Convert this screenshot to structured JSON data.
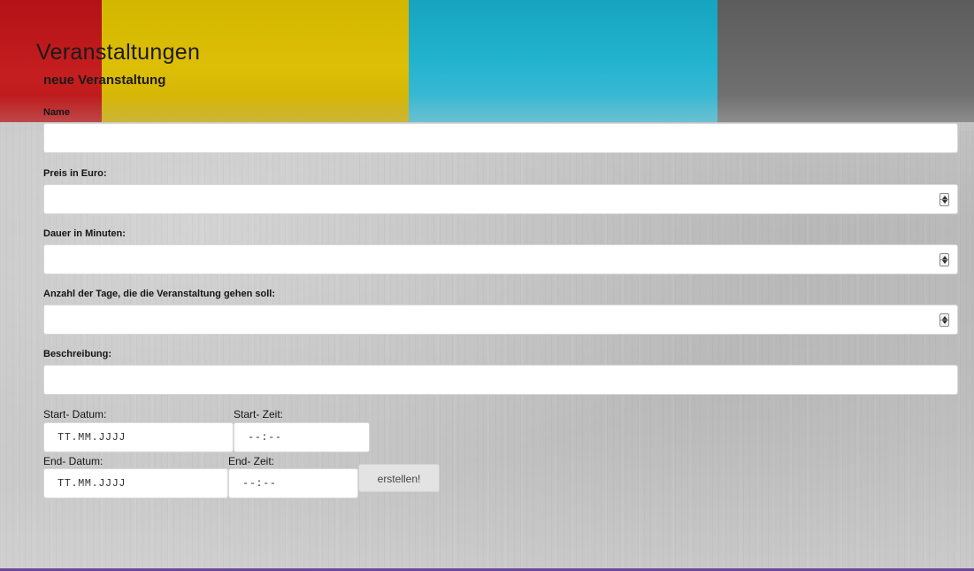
{
  "header": {
    "title": "Veranstaltungen",
    "subtitle": "neue Veranstaltung"
  },
  "form": {
    "name_label": "Name",
    "price_label": "Preis in Euro:",
    "duration_label": "Dauer in Minuten:",
    "days_label": "Anzahl der Tage, die die Veranstaltung gehen soll:",
    "description_label": "Beschreibung:",
    "start_date_label": "Start- Datum:",
    "start_date_placeholder": "TT.MM.JJJJ",
    "start_time_label": "Start- Zeit:",
    "start_time_placeholder": "--:--",
    "end_date_label": "End- Datum:",
    "end_date_placeholder": "TT.MM.JJJJ",
    "end_time_label": "End- Zeit:",
    "end_time_placeholder": "--:--",
    "submit_label": "erstellen!"
  },
  "colors": {
    "band_red": "#c41e20",
    "band_yellow": "#ddbf07",
    "band_cyan": "#22b3cf",
    "band_grey": "#6b6b6b",
    "bottom_line": "#6a4a9a"
  }
}
